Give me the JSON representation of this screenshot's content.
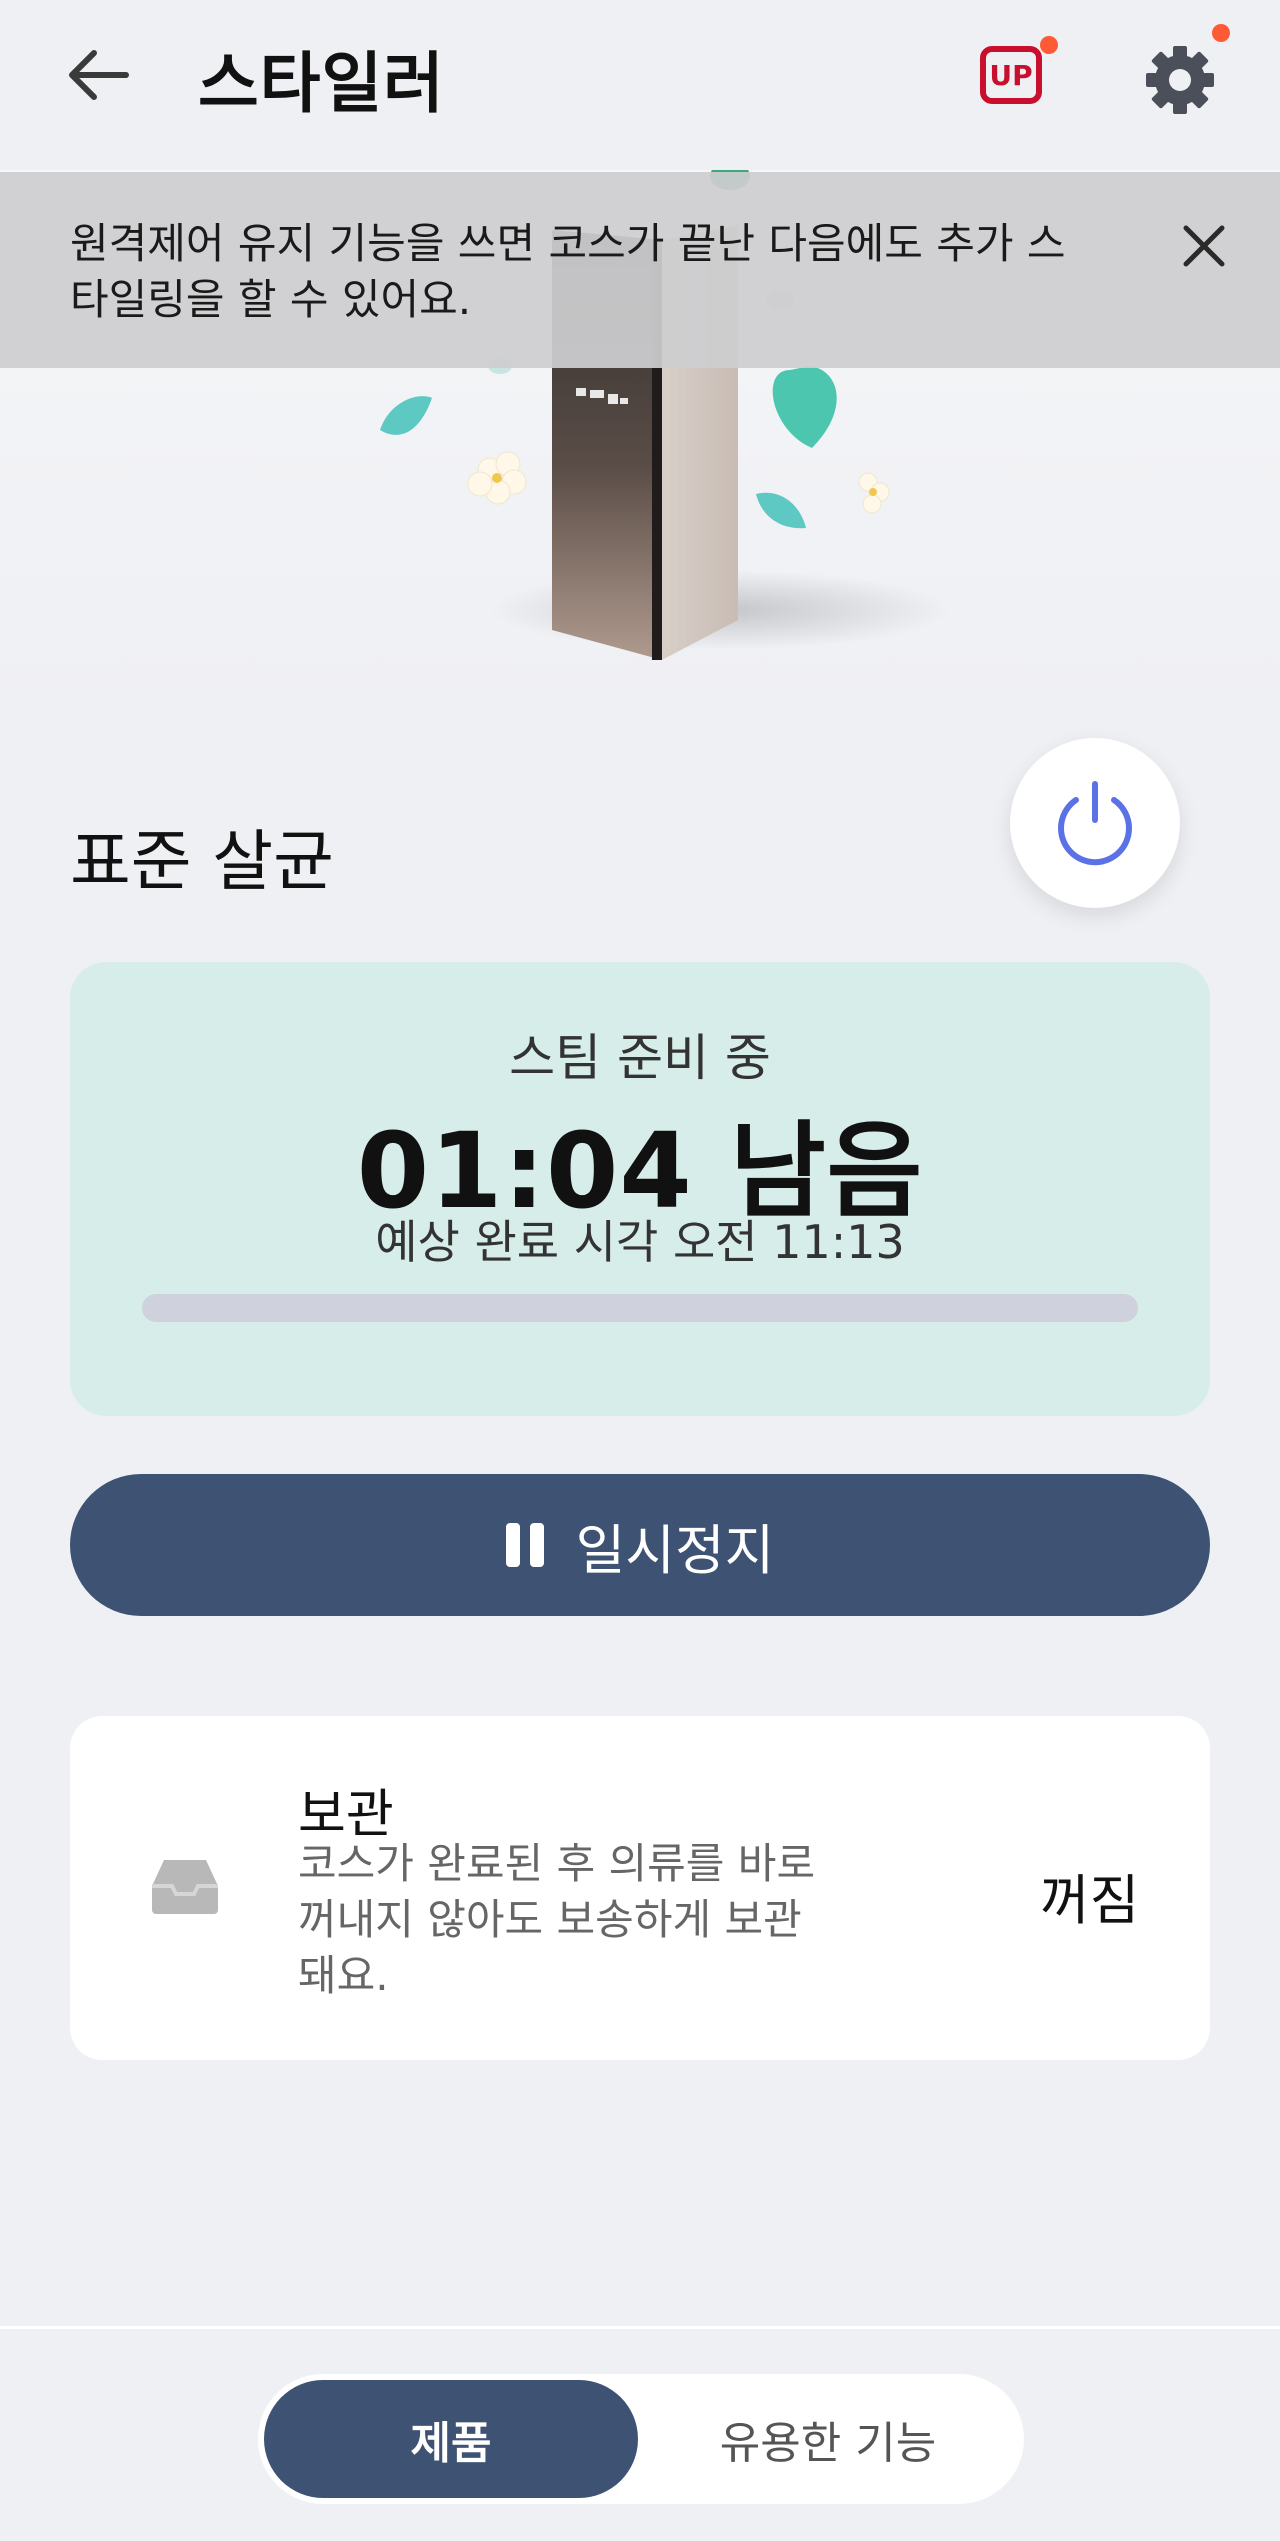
{
  "header": {
    "title": "스타일러",
    "back_icon": "arrow-left-icon",
    "upgrade_badge": "UP",
    "settings_icon": "gear-icon",
    "notification_color": "#ff5a36"
  },
  "banner": {
    "text": "원격제어 유지 기능을 쓰면 코스가 끝난 다음에도 추가 스타일링을 할 수 있어요.",
    "close_icon": "close-icon"
  },
  "course": {
    "name": "표준 살균",
    "power_icon": "power-icon",
    "power_color": "#5b72e6"
  },
  "status": {
    "phase": "스팀 준비 중",
    "remaining": "01:04 남음",
    "eta": "예상 완료 시각 오전 11:13",
    "progress_percent": 0
  },
  "pause_button": {
    "label": "일시정지",
    "icon": "pause-icon"
  },
  "storage": {
    "title": "보관",
    "description": "코스가 완료된 후 의류를 바로 꺼내지 않아도 보송하게 보관돼요.",
    "state": "꺼짐",
    "icon": "tray-icon"
  },
  "tabs": [
    {
      "label": "제품",
      "active": true
    },
    {
      "label": "유용한 기능",
      "active": false
    }
  ],
  "colors": {
    "background": "#eff0f4",
    "accent": "#3e5373",
    "status_card": "#d7ede9",
    "up_red": "#c8102e"
  }
}
